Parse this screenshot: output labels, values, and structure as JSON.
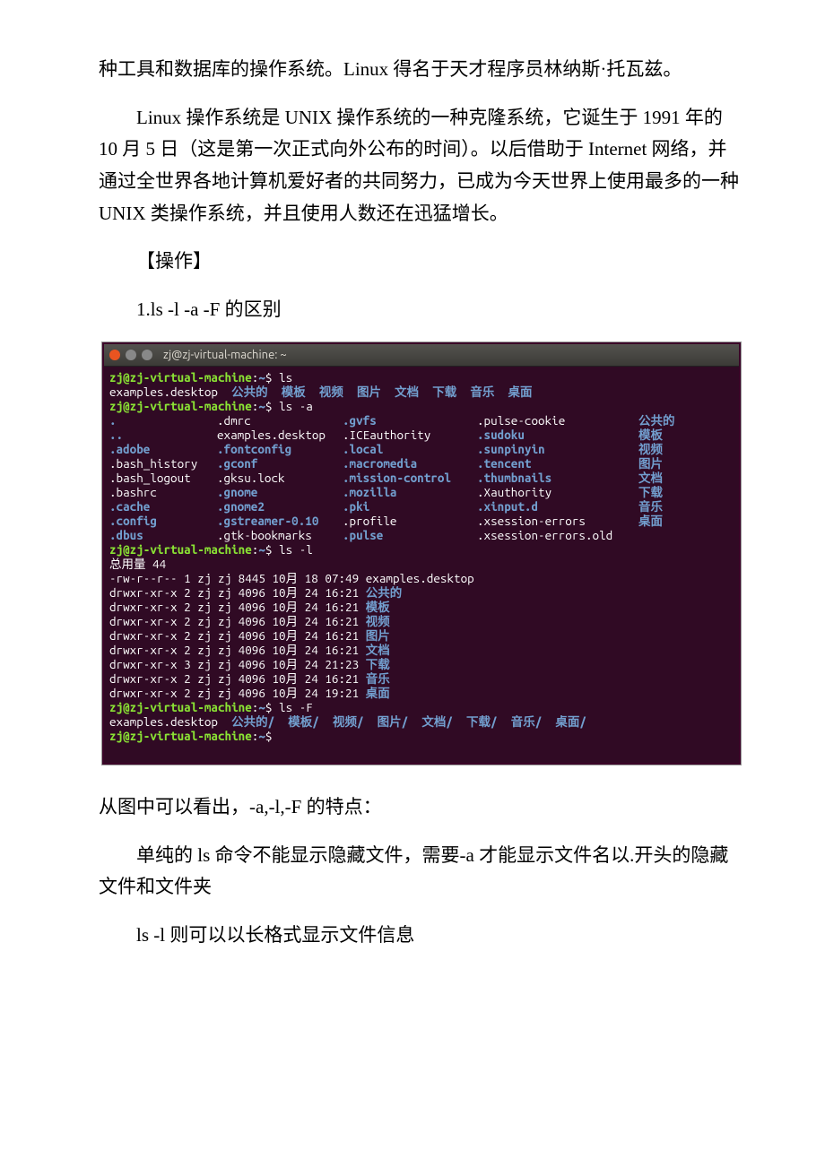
{
  "paragraphs": {
    "p1": "种工具和数据库的操作系统。Linux 得名于天才程序员林纳斯·托瓦兹。",
    "p2": "Linux 操作系统是 UNIX 操作系统的一种克隆系统，它诞生于 1991 年的 10 月 5 日（这是第一次正式向外公布的时间）。以后借助于 Internet 网络，并通过全世界各地计算机爱好者的共同努力，已成为今天世界上使用最多的一种 UNIX 类操作系统，并且使用人数还在迅猛增长。",
    "p3": "【操作】",
    "p4": "1.ls -l -a -F 的区别",
    "p5": "从图中可以看出，-a,-l,-F 的特点：",
    "p6": "单纯的 ls 命令不能显示隐藏文件，需要-a 才能显示文件名以.开头的隐藏文件和文件夹",
    "p7": "ls -l 则可以以长格式显示文件信息"
  },
  "terminal": {
    "title": "zj@zj-virtual-machine: ~",
    "prompt_user": "zj@zj-virtual-machine",
    "prompt_path": "~",
    "cmd_ls": "ls",
    "cmd_lsa": "ls -a",
    "cmd_lsl": "ls -l",
    "cmd_lsF": "ls -F",
    "ls_out": {
      "f0": "examples.desktop",
      "d0": "公共的",
      "d1": "模板",
      "d2": "视频",
      "d3": "图片",
      "d4": "文档",
      "d5": "下载",
      "d6": "音乐",
      "d7": "桌面"
    },
    "lsa": {
      "r0c0": ".",
      "r0c1": ".dmrc",
      "r0c2": ".gvfs",
      "r0c3": ".pulse-cookie",
      "r0c4": "公共的",
      "r1c0": "..",
      "r1c1": "examples.desktop",
      "r1c2": ".ICEauthority",
      "r1c3": ".sudoku",
      "r1c4": "模板",
      "r2c0": ".adobe",
      "r2c1": ".fontconfig",
      "r2c2": ".local",
      "r2c3": ".sunpinyin",
      "r2c4": "视频",
      "r3c0": ".bash_history",
      "r3c1": ".gconf",
      "r3c2": ".macromedia",
      "r3c3": ".tencent",
      "r3c4": "图片",
      "r4c0": ".bash_logout",
      "r4c1": ".gksu.lock",
      "r4c2": ".mission-control",
      "r4c3": ".thumbnails",
      "r4c4": "文档",
      "r5c0": ".bashrc",
      "r5c1": ".gnome",
      "r5c2": ".mozilla",
      "r5c3": ".Xauthority",
      "r5c4": "下载",
      "r6c0": ".cache",
      "r6c1": ".gnome2",
      "r6c2": ".pki",
      "r6c3": ".xinput.d",
      "r6c4": "音乐",
      "r7c0": ".config",
      "r7c1": ".gstreamer-0.10",
      "r7c2": ".profile",
      "r7c3": ".xsession-errors",
      "r7c4": "桌面",
      "r8c0": ".dbus",
      "r8c1": ".gtk-bookmarks",
      "r8c2": ".pulse",
      "r8c3": ".xsession-errors.old"
    },
    "lsl_total": "总用量 44",
    "lsl_rows": [
      {
        "perm": "-rw-r--r--",
        "n": "1",
        "u": "zj",
        "g": "zj",
        "sz": "8445",
        "mo": "10月",
        "da": "18",
        "ti": "07:49",
        "name": "examples.desktop",
        "dir": false
      },
      {
        "perm": "drwxr-xr-x",
        "n": "2",
        "u": "zj",
        "g": "zj",
        "sz": "4096",
        "mo": "10月",
        "da": "24",
        "ti": "16:21",
        "name": "公共的",
        "dir": true
      },
      {
        "perm": "drwxr-xr-x",
        "n": "2",
        "u": "zj",
        "g": "zj",
        "sz": "4096",
        "mo": "10月",
        "da": "24",
        "ti": "16:21",
        "name": "模板",
        "dir": true
      },
      {
        "perm": "drwxr-xr-x",
        "n": "2",
        "u": "zj",
        "g": "zj",
        "sz": "4096",
        "mo": "10月",
        "da": "24",
        "ti": "16:21",
        "name": "视频",
        "dir": true
      },
      {
        "perm": "drwxr-xr-x",
        "n": "2",
        "u": "zj",
        "g": "zj",
        "sz": "4096",
        "mo": "10月",
        "da": "24",
        "ti": "16:21",
        "name": "图片",
        "dir": true
      },
      {
        "perm": "drwxr-xr-x",
        "n": "2",
        "u": "zj",
        "g": "zj",
        "sz": "4096",
        "mo": "10月",
        "da": "24",
        "ti": "16:21",
        "name": "文档",
        "dir": true
      },
      {
        "perm": "drwxr-xr-x",
        "n": "3",
        "u": "zj",
        "g": "zj",
        "sz": "4096",
        "mo": "10月",
        "da": "24",
        "ti": "21:23",
        "name": "下载",
        "dir": true
      },
      {
        "perm": "drwxr-xr-x",
        "n": "2",
        "u": "zj",
        "g": "zj",
        "sz": "4096",
        "mo": "10月",
        "da": "24",
        "ti": "16:21",
        "name": "音乐",
        "dir": true
      },
      {
        "perm": "drwxr-xr-x",
        "n": "2",
        "u": "zj",
        "g": "zj",
        "sz": "4096",
        "mo": "10月",
        "da": "24",
        "ti": "19:21",
        "name": "桌面",
        "dir": true
      }
    ],
    "lsF": {
      "f0": "examples.desktop",
      "d0": "公共的/",
      "d1": "模板/",
      "d2": "视频/",
      "d3": "图片/",
      "d4": "文档/",
      "d5": "下载/",
      "d6": "音乐/",
      "d7": "桌面/"
    }
  }
}
